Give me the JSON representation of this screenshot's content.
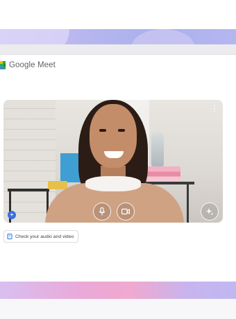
{
  "app": {
    "title": "Google Meet"
  },
  "video_preview": {
    "controls": {
      "mic_icon": "microphone-icon",
      "camera_icon": "camera-icon",
      "effects_icon": "sparkle-effects-icon",
      "more_icon": "more-vertical-icon"
    },
    "badge_icon": "plus-badge-icon"
  },
  "check_chip": {
    "icon": "device-check-icon",
    "label": "Check your audio and video"
  },
  "colors": {
    "brand_green": "#34a853",
    "brand_yellow": "#fbbc04",
    "brand_blue": "#4285f4",
    "brand_red": "#ea4335",
    "top_band": "#b8b6ee",
    "bottom_band": "#eaa9d8"
  }
}
